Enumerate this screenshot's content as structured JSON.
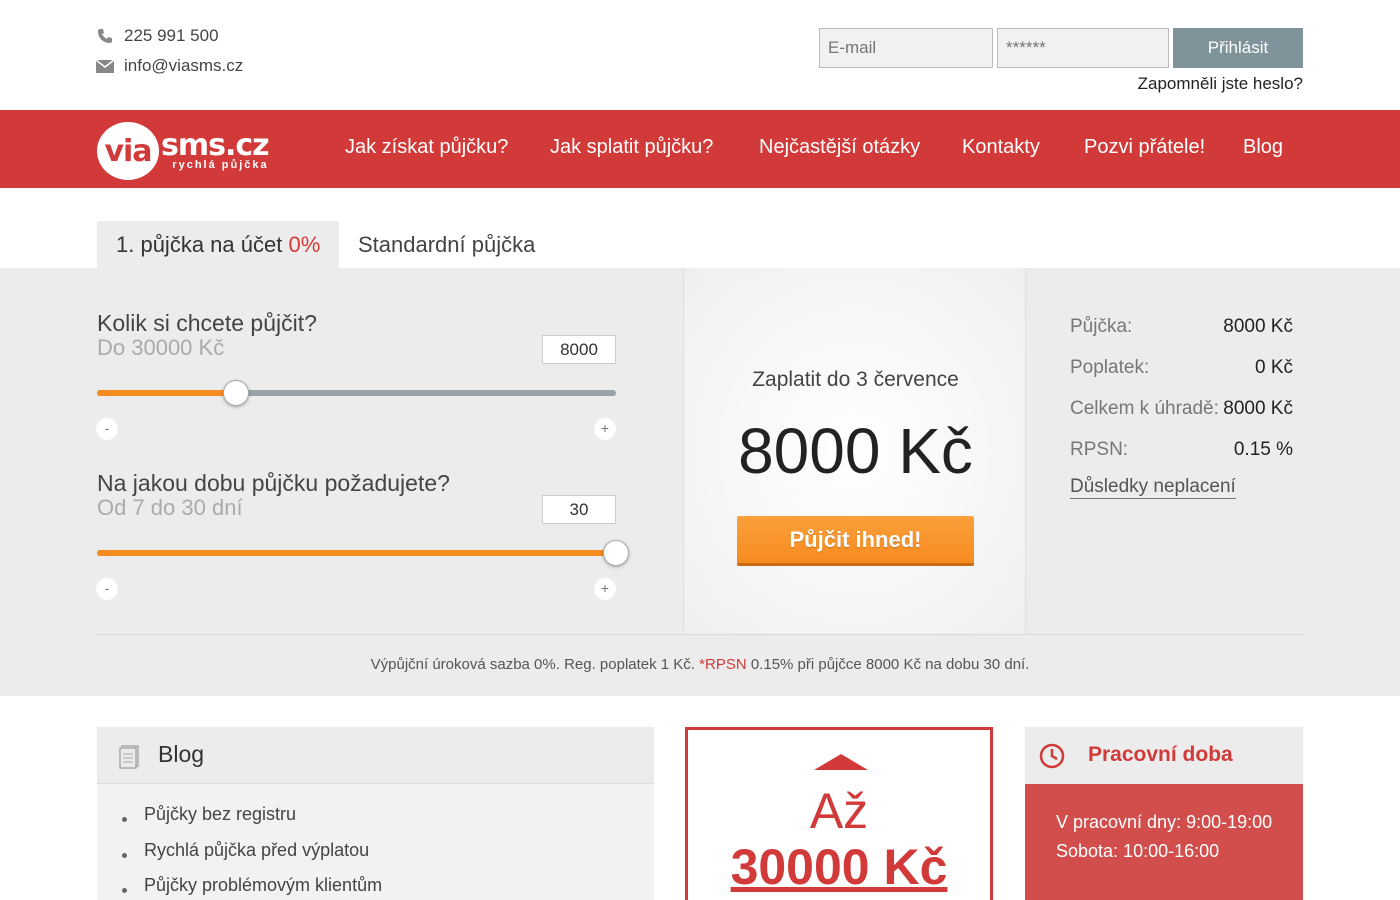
{
  "contact": {
    "phone": "225 991 500",
    "email": "info@viasms.cz"
  },
  "login": {
    "email_placeholder": "E-mail",
    "password_placeholder": "******",
    "submit_label": "Přihlásit",
    "forgot_label": "Zapomněli jste heslo?"
  },
  "logo": {
    "circle_text": "via",
    "main_text": "sms.cz",
    "sub_text": "rychlá půjčka"
  },
  "nav": {
    "items": [
      {
        "label": "Jak získat půjčku?"
      },
      {
        "label": "Jak splatit půjčku?"
      },
      {
        "label": "Nejčastější otázky"
      },
      {
        "label": "Kontakty"
      },
      {
        "label": "Pozvi přátele!"
      },
      {
        "label": "Blog"
      }
    ]
  },
  "tabs": {
    "first_label": "1. půjčka na účet ",
    "first_pct": "0%",
    "standard_label": "Standardní půjčka"
  },
  "calculator": {
    "amount": {
      "question": "Kolik si chcete půjčit?",
      "range_text": "Do 30000 Kč",
      "value": "8000",
      "fill_fraction": 0.267,
      "minus": "-",
      "plus": "+"
    },
    "duration": {
      "question": "Na jakou dobu půjčku požadujete?",
      "range_text": "Od 7 do 30 dní",
      "value": "30",
      "fill_fraction": 1.0,
      "minus": "-",
      "plus": "+"
    },
    "pay_until": "Zaplatit do 3 července",
    "total_display": "8000 Kč",
    "borrow_button": "Půjčit ihned!",
    "summary": [
      {
        "label": "Půjčka:",
        "value": "8000 Kč"
      },
      {
        "label": "Poplatek:",
        "value": "0 Kč"
      },
      {
        "label": "Celkem k úhradě:",
        "value": "8000 Kč"
      },
      {
        "label": "RPSN:",
        "value": "0.15 %"
      }
    ],
    "consequences_link": "Důsledky neplacení",
    "note_before": "Výpůjční úroková sazba 0%. Reg. poplatek 1 Kč. ",
    "note_rpsn": "*RPSN",
    "note_after": " 0.15% při půjčce 8000 Kč na dobu 30 dní."
  },
  "blog": {
    "title": "Blog",
    "items": [
      {
        "label": "Půjčky bez registru"
      },
      {
        "label": "Rychlá půjčka před výplatou"
      },
      {
        "label": "Půjčky problémovým klientům"
      }
    ]
  },
  "promo": {
    "line1": "Až",
    "line2": "30000 Kč"
  },
  "hours": {
    "title": "Pracovní doba",
    "weekdays": "V pracovní dny: 9:00-19:00",
    "saturday": "Sobota: 10:00-16:00"
  },
  "colors": {
    "brand_red": "#d13a39",
    "accent_orange": "#f68b1f",
    "login_button": "#7f939b"
  }
}
